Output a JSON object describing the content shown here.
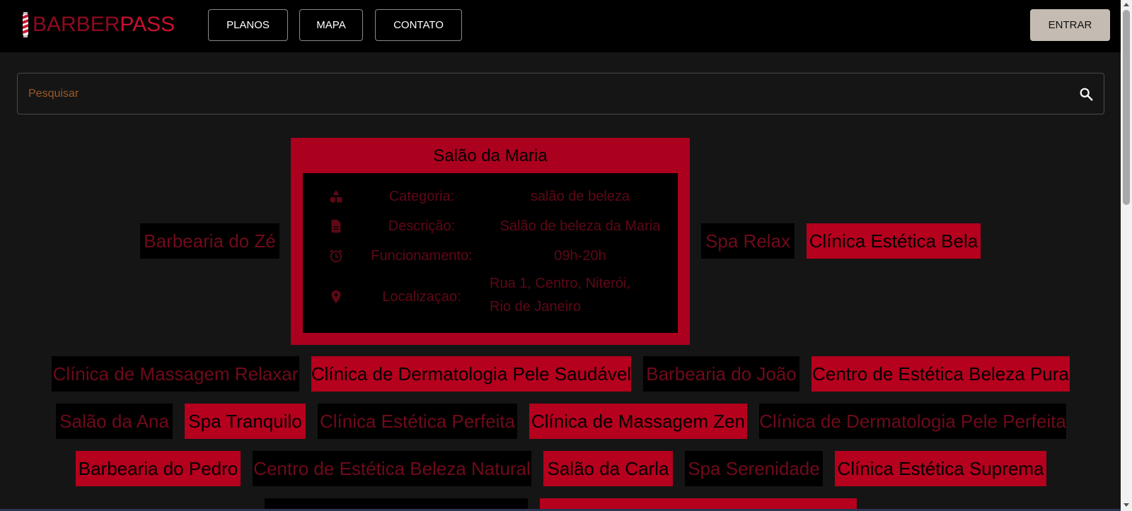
{
  "brand": {
    "part1": "BARBER",
    "part2": "PASS"
  },
  "nav": {
    "planos": "PLANOS",
    "mapa": "MAPA",
    "contato": "CONTATO",
    "login": "ENTRAR"
  },
  "search": {
    "placeholder": "Pesquisar"
  },
  "detail": {
    "title": "Salão da Maria",
    "rows": [
      {
        "icon": "category-icon",
        "label": "Categoria:",
        "value": "salão de beleza"
      },
      {
        "icon": "document-icon",
        "label": "Descrição:",
        "value": "Salão de beleza da Maria"
      },
      {
        "icon": "alarm-icon",
        "label": "Funcionamento:",
        "value": "09h-20h"
      },
      {
        "icon": "location-pin-icon",
        "label": "Localizaçao:",
        "value_line1": "Rua 1, Centro, Niterói,",
        "value_line2": "Rio de Janeiro"
      }
    ]
  },
  "businesses": [
    "Barbearia do Zé",
    "Spa Relax",
    "Clínica Estética Bela",
    "Clínica de Massagem Relaxar",
    "Clínica de Dermatologia Pele Saudável",
    "Barbearia do João",
    "Centro de Estética Beleza Pura",
    "Salão da Ana",
    "Spa Tranquilo",
    "Clínica Estética Perfeita",
    "Clínica de Massagem Zen",
    "Clínica de Dermatologia Pele Perfeita",
    "Barbearia do Pedro",
    "Centro de Estética Beleza Natural",
    "Salão da Carla",
    "Spa Serenidade",
    "Clínica Estética Suprema"
  ],
  "colors": {
    "accent": "#b5001e",
    "dark_chip_text": "#6f0a1a",
    "login_bg": "#c4bcb2"
  }
}
